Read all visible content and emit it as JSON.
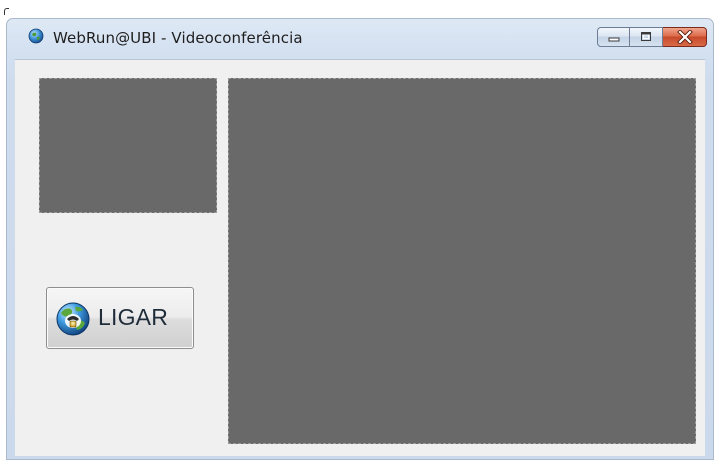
{
  "window": {
    "title": "WebRun@UBI - Videoconferência",
    "icon": "globe-icon",
    "caption_buttons": [
      "minimize-icon",
      "maximize-icon",
      "close-icon"
    ]
  },
  "video": {
    "local_color": "#696969",
    "remote_color": "#696969"
  },
  "call_button": {
    "label": "LIGAR",
    "icon": "globe-phone-icon"
  },
  "colors": {
    "close_button": "#c74a2b",
    "client_background": "#f0f0f0"
  }
}
